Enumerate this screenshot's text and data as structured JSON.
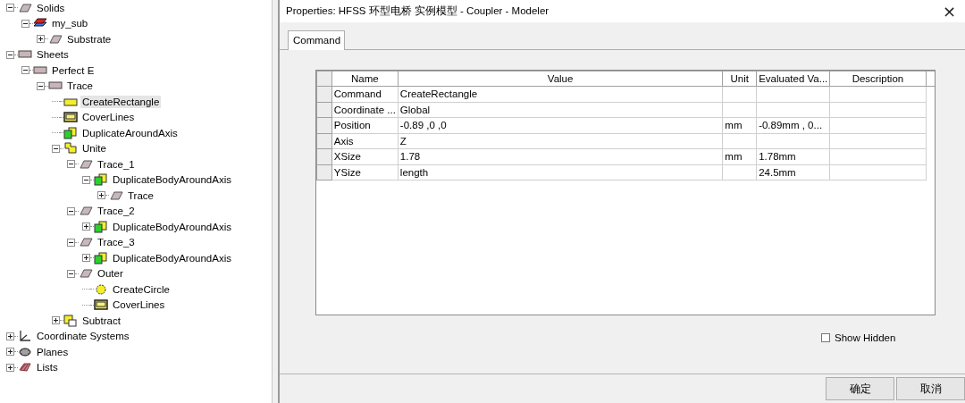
{
  "tree": [
    {
      "label": "Solids",
      "kind": "solid",
      "expanded": true,
      "selected": false,
      "children": [
        {
          "label": "my_sub",
          "kind": "material",
          "expanded": true,
          "selected": false,
          "children": [
            {
              "label": "Substrate",
              "kind": "solid",
              "expanded": false,
              "selected": false
            }
          ]
        }
      ]
    },
    {
      "label": "Sheets",
      "kind": "sheet",
      "expanded": true,
      "selected": false,
      "children": [
        {
          "label": "Perfect E",
          "kind": "sheet",
          "expanded": true,
          "selected": false,
          "children": [
            {
              "label": "Trace",
              "kind": "sheet",
              "expanded": true,
              "selected": false,
              "children": [
                {
                  "label": "CreateRectangle",
                  "kind": "rectangle",
                  "selected": true
                },
                {
                  "label": "CoverLines",
                  "kind": "cover",
                  "selected": false
                },
                {
                  "label": "DuplicateAroundAxis",
                  "kind": "duplicate",
                  "selected": false
                },
                {
                  "label": "Unite",
                  "kind": "unite",
                  "expanded": true,
                  "selected": false,
                  "children": [
                    {
                      "label": "Trace_1",
                      "kind": "solid",
                      "expanded": true,
                      "selected": false,
                      "children": [
                        {
                          "label": "DuplicateBodyAroundAxis",
                          "kind": "duplicate",
                          "expanded": true,
                          "selected": false,
                          "children": [
                            {
                              "label": "Trace",
                              "kind": "solid",
                              "expanded": false,
                              "selected": false
                            }
                          ]
                        }
                      ]
                    },
                    {
                      "label": "Trace_2",
                      "kind": "solid",
                      "expanded": true,
                      "selected": false,
                      "children": [
                        {
                          "label": "DuplicateBodyAroundAxis",
                          "kind": "duplicate",
                          "expanded": false,
                          "selected": false
                        }
                      ]
                    },
                    {
                      "label": "Trace_3",
                      "kind": "solid",
                      "expanded": true,
                      "selected": false,
                      "children": [
                        {
                          "label": "DuplicateBodyAroundAxis",
                          "kind": "duplicate",
                          "expanded": false,
                          "selected": false
                        }
                      ]
                    },
                    {
                      "label": "Outer",
                      "kind": "solid",
                      "expanded": true,
                      "selected": false,
                      "children": [
                        {
                          "label": "CreateCircle",
                          "kind": "circle",
                          "selected": false
                        },
                        {
                          "label": "CoverLines",
                          "kind": "cover",
                          "selected": false
                        }
                      ]
                    }
                  ]
                },
                {
                  "label": "Subtract",
                  "kind": "subtract",
                  "expanded": false,
                  "selected": false
                }
              ]
            }
          ]
        }
      ]
    },
    {
      "label": "Coordinate Systems",
      "kind": "axes",
      "expanded": false,
      "selected": false
    },
    {
      "label": "Planes",
      "kind": "planes",
      "expanded": false,
      "selected": false
    },
    {
      "label": "Lists",
      "kind": "lists",
      "expanded": false,
      "selected": false
    }
  ],
  "dialog": {
    "title": "Properties: HFSS 环型电桥 实例模型 - Coupler - Modeler",
    "close": "×",
    "tabs": [
      {
        "label": "Command",
        "selected": true
      }
    ],
    "table": {
      "columns": [
        "Name",
        "Value",
        "Unit",
        "Evaluated Va...",
        "Description"
      ],
      "rows": [
        [
          "Command",
          "CreateRectangle",
          "",
          ""
        ],
        [
          "Coordinate ...",
          "Global",
          "",
          ""
        ],
        [
          "Position",
          "-0.89 ,0 ,0",
          "mm",
          "-0.89mm , 0..."
        ],
        [
          "Axis",
          "Z",
          "",
          ""
        ],
        [
          "XSize",
          "1.78",
          "mm",
          "1.78mm"
        ],
        [
          "YSize",
          "length",
          "",
          "24.5mm"
        ]
      ]
    },
    "show_hidden": {
      "label": "Show Hidden",
      "checked": false
    },
    "buttons": [
      "确定",
      "取消"
    ]
  }
}
